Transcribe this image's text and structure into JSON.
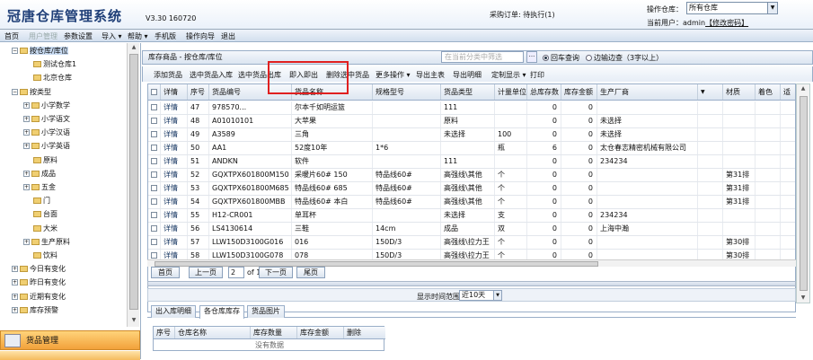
{
  "header": {
    "logo": "冠唐仓库管理系统",
    "version": "V3.30 160720",
    "pending_orders": "采购订单: 待执行(1)",
    "warehouse_label": "操作仓库：",
    "warehouse_value": "所有仓库",
    "user_prefix": "当前用户：admin",
    "change_pwd": "【修改密码】"
  },
  "menu": {
    "items": [
      "首页",
      "用户管理",
      "参数设置",
      "导入 ▾",
      "帮助 ▾",
      "手机版",
      "操作向导",
      "退出"
    ]
  },
  "tree": {
    "nodes": [
      {
        "label": "按仓库/库位",
        "pm": "−",
        "depth": 0,
        "folder": true,
        "selected": true
      },
      {
        "label": "测试仓库1",
        "pm": "",
        "depth": 1,
        "folder": true
      },
      {
        "label": "北京仓库",
        "pm": "",
        "depth": 1,
        "folder": true
      },
      {
        "label": "按类型",
        "pm": "−",
        "depth": 0,
        "folder": true
      },
      {
        "label": "小学数学",
        "pm": "+",
        "depth": 1,
        "folder": true
      },
      {
        "label": "小学语文",
        "pm": "+",
        "depth": 1,
        "folder": true
      },
      {
        "label": "小学汉语",
        "pm": "+",
        "depth": 1,
        "folder": true
      },
      {
        "label": "小学英语",
        "pm": "+",
        "depth": 1,
        "folder": true
      },
      {
        "label": "原料",
        "pm": "",
        "depth": 1,
        "folder": true
      },
      {
        "label": "成品",
        "pm": "+",
        "depth": 1,
        "folder": true
      },
      {
        "label": "五金",
        "pm": "+",
        "depth": 1,
        "folder": true
      },
      {
        "label": "门",
        "pm": "",
        "depth": 1,
        "folder": true
      },
      {
        "label": "台面",
        "pm": "",
        "depth": 1,
        "folder": true
      },
      {
        "label": "大米",
        "pm": "",
        "depth": 1,
        "folder": true
      },
      {
        "label": "生产原料",
        "pm": "+",
        "depth": 1,
        "folder": true
      },
      {
        "label": "饮料",
        "pm": "",
        "depth": 1,
        "folder": true
      },
      {
        "label": "今日有变化",
        "pm": "+",
        "depth": 0,
        "folder": true
      },
      {
        "label": "昨日有变化",
        "pm": "+",
        "depth": 0,
        "folder": true
      },
      {
        "label": "近期有变化",
        "pm": "+",
        "depth": 0,
        "folder": true
      },
      {
        "label": "库存预警",
        "pm": "+",
        "depth": 0,
        "folder": true
      }
    ]
  },
  "nav": {
    "goods": "货品管理"
  },
  "panel": {
    "title": "库存商品 - 按仓库/库位",
    "search_placeholder": "在当前分类中筛选",
    "search_btn": "···",
    "radio_local": "回车查询",
    "radio_live": "边输边查（3字以上）"
  },
  "toolbar": {
    "items": [
      "添加货品",
      "选中货品入库",
      "选中货品出库",
      "即入即出",
      "删除选中货品",
      "更多操作 ▾",
      "导出主表",
      "导出明细",
      "定制显示 ▾",
      "打印"
    ]
  },
  "grid": {
    "headers": [
      "",
      "详情",
      "序号",
      "货品编号",
      "货品名称",
      "规格型号",
      "货品类型",
      "计量单位",
      "总库存数",
      "库存金额",
      "生产厂商",
      "",
      "材质",
      "着色",
      "适"
    ],
    "rows": [
      [
        "",
        "详情",
        "47",
        "978570...",
        "尔本千如明运篮",
        "",
        "111",
        "",
        "0",
        "0",
        "",
        "",
        "",
        "",
        ""
      ],
      [
        "",
        "详情",
        "48",
        "A01010101",
        "大苹果",
        "",
        "原料",
        "",
        "0",
        "0",
        "未选择",
        "",
        "",
        "",
        ""
      ],
      [
        "",
        "详情",
        "49",
        "A3589",
        "三角",
        "",
        "未选择",
        "100",
        "0",
        "0",
        "未选择",
        "",
        "",
        "",
        ""
      ],
      [
        "",
        "详情",
        "50",
        "AA1",
        "52度10年",
        "1*6",
        "",
        "瓶",
        "6",
        "0",
        "太仓春志精密机械有限公司",
        "",
        "",
        "",
        ""
      ],
      [
        "",
        "详情",
        "51",
        "ANDKN",
        "软件",
        "",
        "111",
        "",
        "0",
        "0",
        "234234",
        "",
        "",
        "",
        ""
      ],
      [
        "",
        "详情",
        "52",
        "GQXTPX601800M150",
        "采暖片60# 150",
        "特品线60#",
        "高强线\\其他",
        "个",
        "0",
        "0",
        "",
        "",
        "第31排",
        "",
        ""
      ],
      [
        "",
        "详情",
        "53",
        "GQXTPX601800M685",
        "特品线60# 685",
        "特品线60#",
        "高强线\\其他",
        "个",
        "0",
        "0",
        "",
        "",
        "第31排",
        "",
        ""
      ],
      [
        "",
        "详情",
        "54",
        "GQXTPX601800MBB",
        "特品线60# 本白",
        "特品线60#",
        "高强线\\其他",
        "个",
        "0",
        "0",
        "",
        "",
        "第31排",
        "",
        ""
      ],
      [
        "",
        "详情",
        "55",
        "H12-CR001",
        "单耳杯",
        "",
        "未选择",
        "支",
        "0",
        "0",
        "234234",
        "",
        "",
        "",
        ""
      ],
      [
        "",
        "详情",
        "56",
        "LS4130614",
        "三鞋",
        "14cm",
        "成品",
        "双",
        "0",
        "0",
        "上海中瀚",
        "",
        "",
        "",
        ""
      ],
      [
        "",
        "详情",
        "57",
        "LLW150D3100G016",
        "016",
        "150D/3",
        "高强线\\拉力王",
        "个",
        "0",
        "0",
        "",
        "",
        "第30排",
        "",
        ""
      ],
      [
        "",
        "详情",
        "58",
        "LLW150D3100G078",
        "078",
        "150D/3",
        "高强线\\拉力王",
        "个",
        "0",
        "0",
        "",
        "",
        "第30排",
        "",
        ""
      ]
    ]
  },
  "pager": {
    "first": "首页",
    "prev": "上一页",
    "current": "2",
    "total": "of 13",
    "next": "下一页",
    "last": "尾页"
  },
  "timebar": {
    "label": "显示时间范围",
    "value": "近10天"
  },
  "tabs": {
    "items": [
      "出入库明细",
      "各仓库库存",
      "货品图片"
    ]
  },
  "subgrid": {
    "headers": [
      "序号",
      "仓库名称",
      "库存数量",
      "库存金额",
      "删除"
    ],
    "empty": "没有数据"
  }
}
